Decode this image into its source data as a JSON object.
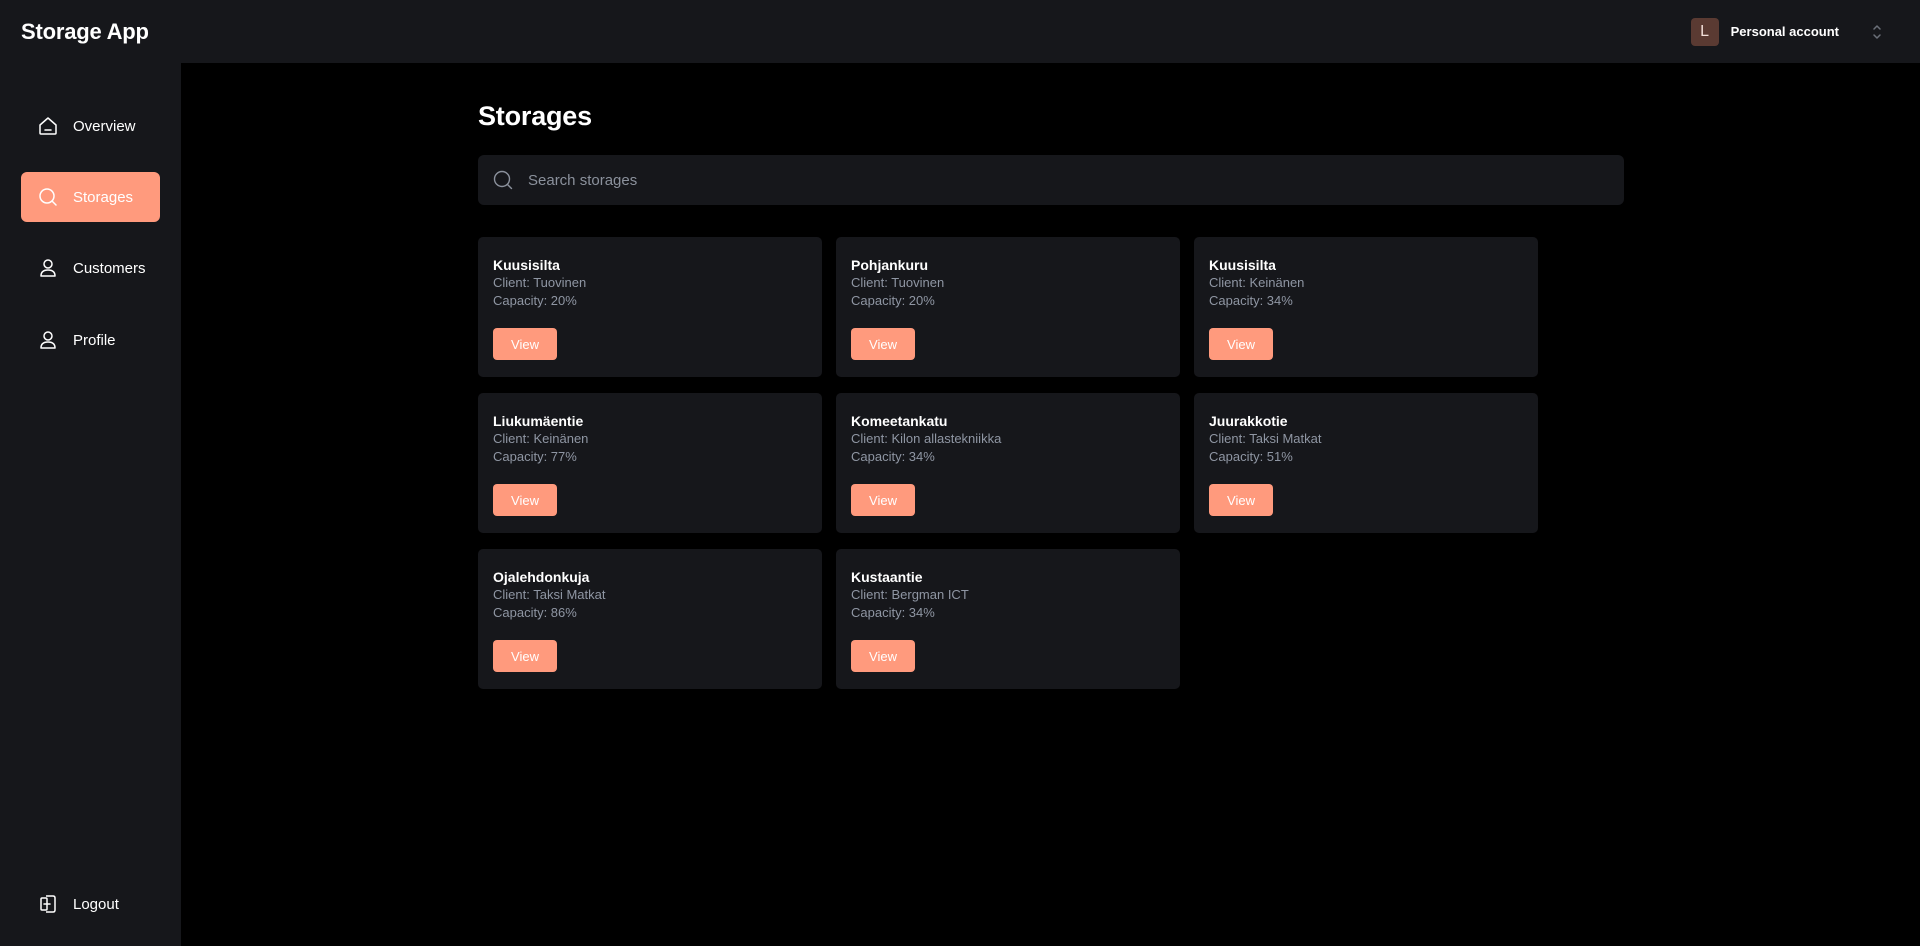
{
  "app": {
    "title": "Storage App"
  },
  "account": {
    "initial": "L",
    "label": "Personal account"
  },
  "sidebar": {
    "items": [
      {
        "label": "Overview",
        "icon": "home-icon",
        "active": false
      },
      {
        "label": "Storages",
        "icon": "search-icon",
        "active": true
      },
      {
        "label": "Customers",
        "icon": "user-icon",
        "active": false
      },
      {
        "label": "Profile",
        "icon": "user-icon",
        "active": false
      }
    ],
    "logout": {
      "label": "Logout",
      "icon": "logout-icon"
    }
  },
  "page": {
    "title": "Storages"
  },
  "search": {
    "placeholder": "Search storages"
  },
  "storages": [
    {
      "name": "Kuusisilta",
      "client": "Client: Tuovinen",
      "capacity": "Capacity: 20%",
      "button": "View"
    },
    {
      "name": "Pohjankuru",
      "client": "Client: Tuovinen",
      "capacity": "Capacity: 20%",
      "button": "View"
    },
    {
      "name": "Kuusisilta",
      "client": "Client: Keinänen",
      "capacity": "Capacity: 34%",
      "button": "View"
    },
    {
      "name": "Liukumäentie",
      "client": "Client: Keinänen",
      "capacity": "Capacity: 77%",
      "button": "View"
    },
    {
      "name": "Komeetankatu",
      "client": "Client: Kilon allastekniikka",
      "capacity": "Capacity: 34%",
      "button": "View"
    },
    {
      "name": "Juurakkotie",
      "client": "Client: Taksi Matkat",
      "capacity": "Capacity: 51%",
      "button": "View"
    },
    {
      "name": "Ojalehdonkuja",
      "client": "Client: Taksi Matkat",
      "capacity": "Capacity: 86%",
      "button": "View"
    },
    {
      "name": "Kustaantie",
      "client": "Client: Bergman ICT",
      "capacity": "Capacity: 34%",
      "button": "View"
    }
  ],
  "colors": {
    "accent": "#ff9a7d",
    "panel": "#16171b",
    "background": "#000000",
    "muted_text": "#8f96a3"
  }
}
